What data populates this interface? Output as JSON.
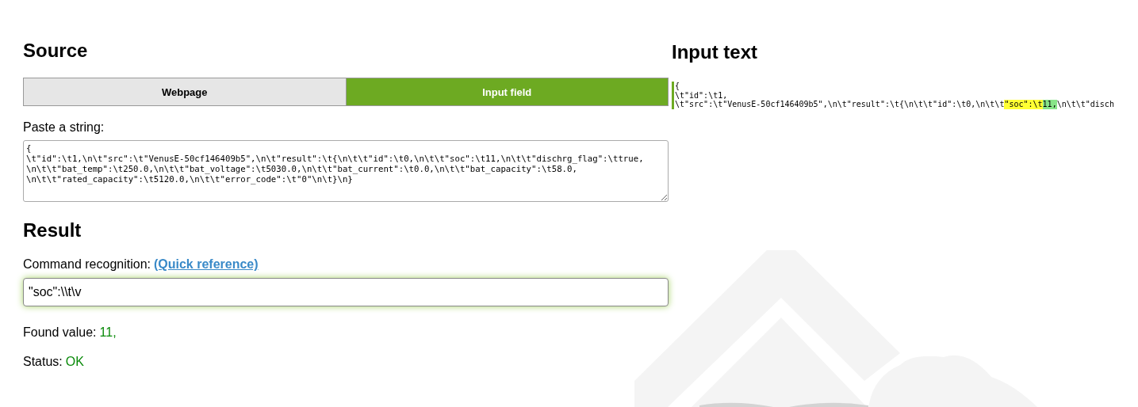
{
  "source": {
    "heading": "Source",
    "options": [
      {
        "label": "Webpage",
        "selected": false
      },
      {
        "label": "Input field",
        "selected": true
      }
    ],
    "paste_label": "Paste a string:",
    "textarea_value": "{\n\\t\"id\":\\t1,\\n\\t\"src\":\\t\"VenusE-50cf146409b5\",\\n\\t\"result\":\\t{\\n\\t\\t\"id\":\\t0,\\n\\t\\t\"soc\":\\t11,\\n\\t\\t\"dischrg_flag\":\\ttrue,\n\\n\\t\\t\"bat_temp\":\\t250.0,\\n\\t\\t\"bat_voltage\":\\t5030.0,\\n\\t\\t\"bat_current\":\\t0.0,\\n\\t\\t\"bat_capacity\":\\t58.0,\n\\n\\t\\t\"rated_capacity\":\\t5120.0,\\n\\t\\t\"error_code\":\\t\"0\"\\n\\t}\\n}"
  },
  "result": {
    "heading": "Result",
    "command_label": "Command recognition:",
    "quick_reference_link": "(Quick reference)",
    "command_value": "\"soc\":\\\\t\\v",
    "found_label": "Found value:",
    "found_value": "11,",
    "status_label": "Status:",
    "status_value": "OK"
  },
  "input_text": {
    "heading": "Input text",
    "lines": [
      [
        {
          "text": "{",
          "kind": "plain"
        }
      ],
      [
        {
          "text": "\\t\"id\":\\t1,",
          "kind": "plain"
        }
      ],
      [
        {
          "text": "\\t\"src\":\\t\"VenusE-50cf146409b5\",\\n\\t\"result\":\\t{\\n\\t\\t\"id\":\\t0,\\n\\t\\t",
          "kind": "plain"
        },
        {
          "text": "\"soc\":\\t",
          "kind": "match"
        },
        {
          "text": "11,",
          "kind": "value"
        },
        {
          "text": "\\n\\t\\t\"disch",
          "kind": "plain"
        }
      ]
    ]
  }
}
